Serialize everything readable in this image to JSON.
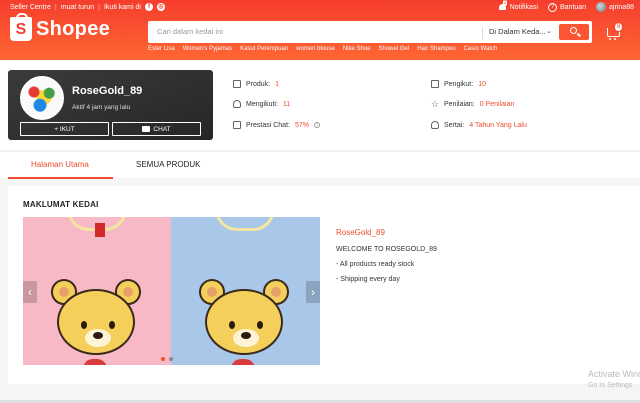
{
  "topbar": {
    "seller_centre": "Seller Centre",
    "download": "muat turun",
    "follow": "Ikuti kami di",
    "notifications": "Notifikasi",
    "notification_count": "1",
    "help": "Bantuan",
    "username": "ajrina88"
  },
  "header": {
    "logo_text": "Shopee",
    "search_placeholder": "Cari dalam kedai ini",
    "search_scope": "Di Dalam Keda...",
    "cart_count": "8",
    "keywords": [
      "Ester Lisa",
      "Women's Pyjamas",
      "Kasut Perempuan",
      "women blouse",
      "Nike Shoe",
      "Showel Gel",
      "Hair Shampoo",
      "Casio Watch"
    ]
  },
  "shop_card": {
    "name": "RoseGold_89",
    "active_status": "Aktif 4 jam yang lalu",
    "follow_button": "+ IKUT",
    "chat_button": "CHAT"
  },
  "stats": {
    "products_label": "Produk:",
    "products_value": "1",
    "following_label": "Mengikuti:",
    "following_value": "11",
    "chat_perf_label": "Prestasi Chat:",
    "chat_perf_value": "57%",
    "followers_label": "Pengikut:",
    "followers_value": "10",
    "rating_label": "Penilaian:",
    "rating_value": "0 Penilaian",
    "joined_label": "Sertai:",
    "joined_value": "4 Tahun Yang Lalu"
  },
  "tabs": [
    {
      "label": "Halaman Utama",
      "active": true
    },
    {
      "label": "SEMUA PRODUK",
      "active": false
    }
  ],
  "main": {
    "section_title": "MAKLUMAT KEDAI",
    "shop_name": "RoseGold_89",
    "welcome": "WELCOME TO ROSEGOLD_89",
    "line1": "- All products ready stock",
    "line2": "- Shipping every day"
  },
  "watermark": {
    "line1": "Activate Windows",
    "line2": "Go to Settings"
  },
  "colors": {
    "brand": "#ee4d2d",
    "header_start": "#f53d2d",
    "header_end": "#ff6633"
  }
}
